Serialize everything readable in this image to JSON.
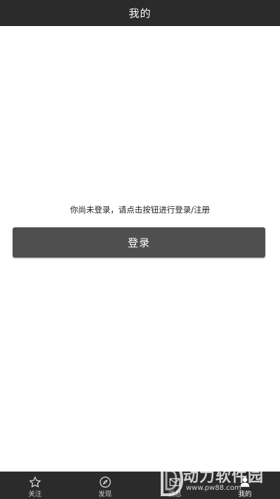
{
  "header": {
    "title": "我的"
  },
  "main": {
    "prompt": "你尚未登录，请点击按钮进行登录/注册",
    "login_label": "登录"
  },
  "tabbar": {
    "items": [
      {
        "label": "关注",
        "icon": "star-icon"
      },
      {
        "label": "发现",
        "icon": "compass-icon"
      },
      {
        "label": "消息",
        "icon": "mail-icon"
      },
      {
        "label": "我的",
        "icon": "user-icon"
      }
    ],
    "active_index": 3
  },
  "watermark": {
    "text": "动力软件园",
    "url": "www.pw88.com"
  },
  "colors": {
    "header_bg": "#2b2b2b",
    "button_bg": "#4f4f4f",
    "page_bg": "#ffffff"
  }
}
